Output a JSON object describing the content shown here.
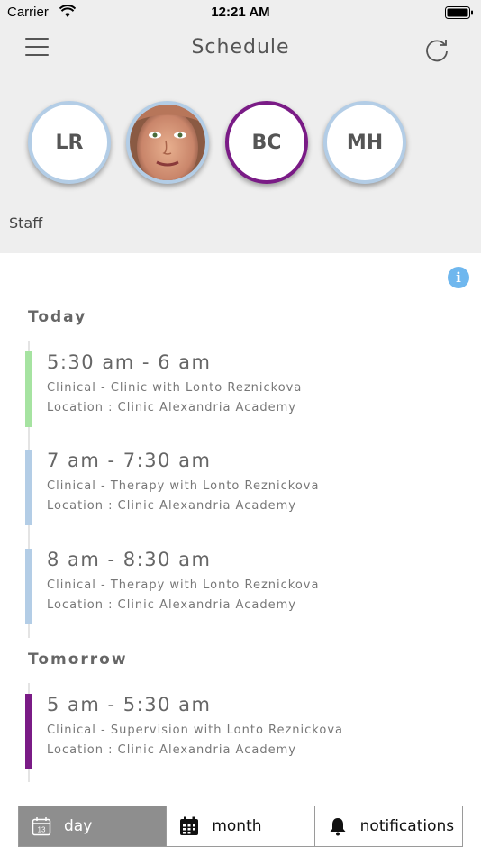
{
  "status_bar": {
    "carrier": "Carrier",
    "time": "12:21 AM"
  },
  "header": {
    "title": "Schedule"
  },
  "staff": {
    "label": "Staff",
    "avatars": [
      {
        "initials": "LR",
        "selected": false
      },
      {
        "initials": "",
        "photo": true,
        "selected": false
      },
      {
        "initials": "BC",
        "selected": true
      },
      {
        "initials": "MH",
        "selected": false
      }
    ]
  },
  "info_icon": "i",
  "sections": {
    "today": "Today",
    "tomorrow": "Tomorrow"
  },
  "events": [
    {
      "time": "5:30 am - 6 am",
      "description": "Clinical - Clinic with Lonto Reznickova",
      "location": "Location : Clinic Alexandria Academy",
      "color": "#a6e3a1"
    },
    {
      "time": "7 am - 7:30 am",
      "description": "Clinical - Therapy with Lonto Reznickova",
      "location": "Location : Clinic Alexandria Academy",
      "color": "#b3cde6"
    },
    {
      "time": "8 am - 8:30 am",
      "description": "Clinical - Therapy with Lonto Reznickova",
      "location": "Location : Clinic Alexandria Academy",
      "color": "#b3cde6"
    },
    {
      "time": "5 am - 5:30 am",
      "description": "Clinical - Supervision with Lonto Reznickova",
      "location": "Location : Clinic Alexandria Academy",
      "color": "#7a1b86"
    }
  ],
  "tabs": [
    {
      "label": "day",
      "icon": "calendar-day-icon",
      "active": true,
      "icon_text": "13"
    },
    {
      "label": "month",
      "icon": "calendar-month-icon",
      "active": false
    },
    {
      "label": "notifications",
      "icon": "bell-icon",
      "active": false
    }
  ],
  "colors": {
    "accent_purple": "#7a1b86",
    "avatar_border": "#b3cde6",
    "info_blue": "#6fb7ee",
    "active_tab": "#8e8e8e"
  }
}
